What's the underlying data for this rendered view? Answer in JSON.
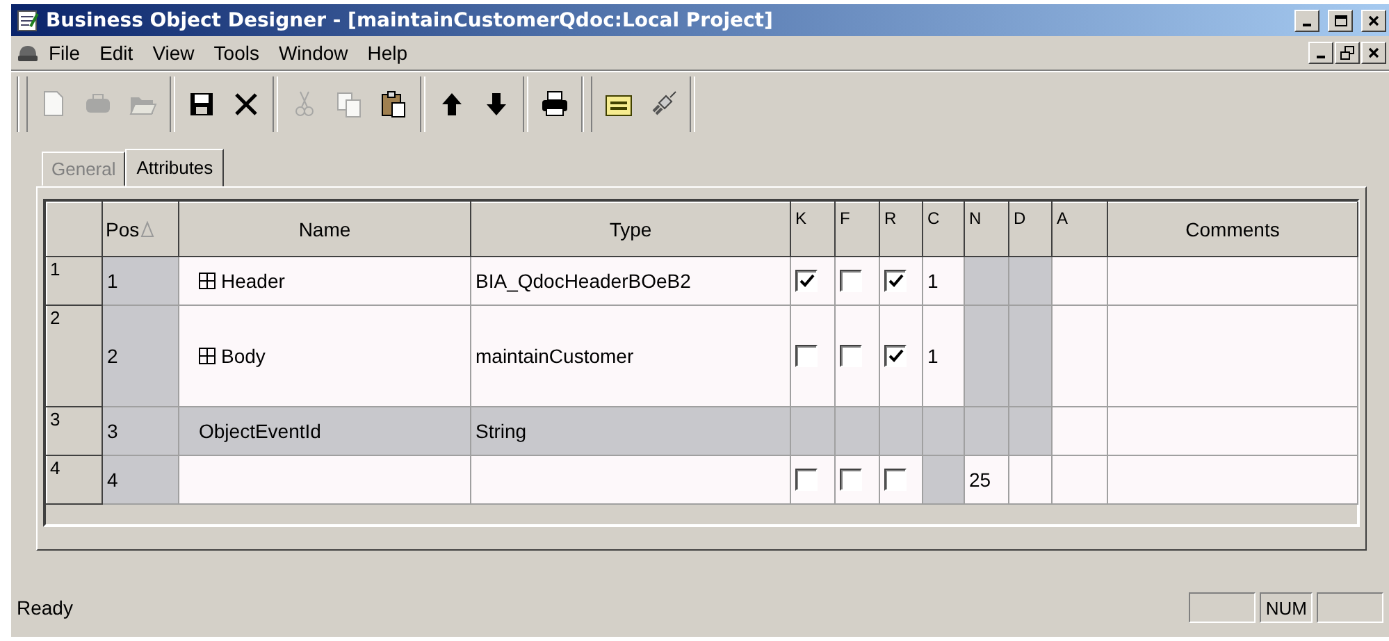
{
  "window": {
    "title": "Business Object Designer - [maintainCustomerQdoc:Local Project]"
  },
  "menu": [
    "File",
    "Edit",
    "View",
    "Tools",
    "Window",
    "Help"
  ],
  "toolbar": [
    {
      "kind": "new",
      "disabled": true
    },
    {
      "kind": "open-db",
      "disabled": true
    },
    {
      "kind": "open-folder",
      "disabled": true
    },
    {
      "kind": "sep"
    },
    {
      "kind": "save",
      "disabled": false
    },
    {
      "kind": "delete",
      "disabled": false
    },
    {
      "kind": "sep"
    },
    {
      "kind": "cut",
      "disabled": true
    },
    {
      "kind": "copy",
      "disabled": true
    },
    {
      "kind": "paste",
      "disabled": false
    },
    {
      "kind": "sep"
    },
    {
      "kind": "up",
      "disabled": false
    },
    {
      "kind": "down",
      "disabled": false
    },
    {
      "kind": "sep"
    },
    {
      "kind": "print",
      "disabled": false
    },
    {
      "kind": "grip"
    },
    {
      "kind": "folder",
      "disabled": false
    },
    {
      "kind": "plug",
      "disabled": false
    },
    {
      "kind": "sep"
    }
  ],
  "tabs": [
    {
      "label": "General",
      "selected": false
    },
    {
      "label": "Attributes",
      "selected": true
    }
  ],
  "table": {
    "columns": [
      "Pos",
      "Name",
      "Type",
      "K",
      "F",
      "R",
      "C",
      "N",
      "D",
      "A",
      "Comments"
    ],
    "rows": [
      {
        "header": "1",
        "cells": [
          {
            "text": "1",
            "shaded": true
          },
          {
            "text": "Header",
            "kind": "tree",
            "shaded": false
          },
          {
            "text": "BIA_QdocHeaderBOeB2",
            "shaded": false
          },
          {
            "kind": "checkbox",
            "checked": true
          },
          {
            "kind": "checkbox",
            "checked": false
          },
          {
            "kind": "checkbox",
            "checked": true
          },
          {
            "text": "1",
            "shaded": false
          },
          {
            "shaded": true
          },
          {
            "shaded": true
          },
          {
            "shaded": false
          },
          {
            "shaded": false
          }
        ]
      },
      {
        "header": "2",
        "cells": [
          {
            "text": "2",
            "shaded": true
          },
          {
            "text": "Body",
            "kind": "tree",
            "shaded": false
          },
          {
            "text": "maintainCustomer",
            "shaded": false
          },
          {
            "kind": "checkbox",
            "checked": false
          },
          {
            "kind": "checkbox",
            "checked": false
          },
          {
            "kind": "checkbox",
            "checked": true
          },
          {
            "text": "1",
            "shaded": false
          },
          {
            "shaded": true
          },
          {
            "shaded": true
          },
          {
            "shaded": false
          },
          {
            "shaded": false
          }
        ]
      },
      {
        "header": "3",
        "cells": [
          {
            "text": "3",
            "shaded": true
          },
          {
            "text": "ObjectEventId",
            "shaded": true
          },
          {
            "text": "String",
            "shaded": true
          },
          {
            "shaded": true
          },
          {
            "shaded": true
          },
          {
            "shaded": true
          },
          {
            "shaded": true
          },
          {
            "shaded": true
          },
          {
            "shaded": true
          },
          {
            "shaded": false
          },
          {
            "shaded": false
          }
        ]
      },
      {
        "header": "4",
        "cells": [
          {
            "text": "4",
            "shaded": true
          },
          {
            "shaded": false
          },
          {
            "shaded": false
          },
          {
            "kind": "checkbox",
            "checked": false
          },
          {
            "kind": "checkbox",
            "checked": false
          },
          {
            "kind": "checkbox",
            "checked": false
          },
          {
            "shaded": true
          },
          {
            "text": "25",
            "shaded": false
          },
          {
            "shaded": false
          },
          {
            "shaded": false
          },
          {
            "shaded": false
          }
        ]
      }
    ]
  },
  "status_bar": {
    "message": "Ready",
    "panels": [
      "NUM"
    ]
  }
}
